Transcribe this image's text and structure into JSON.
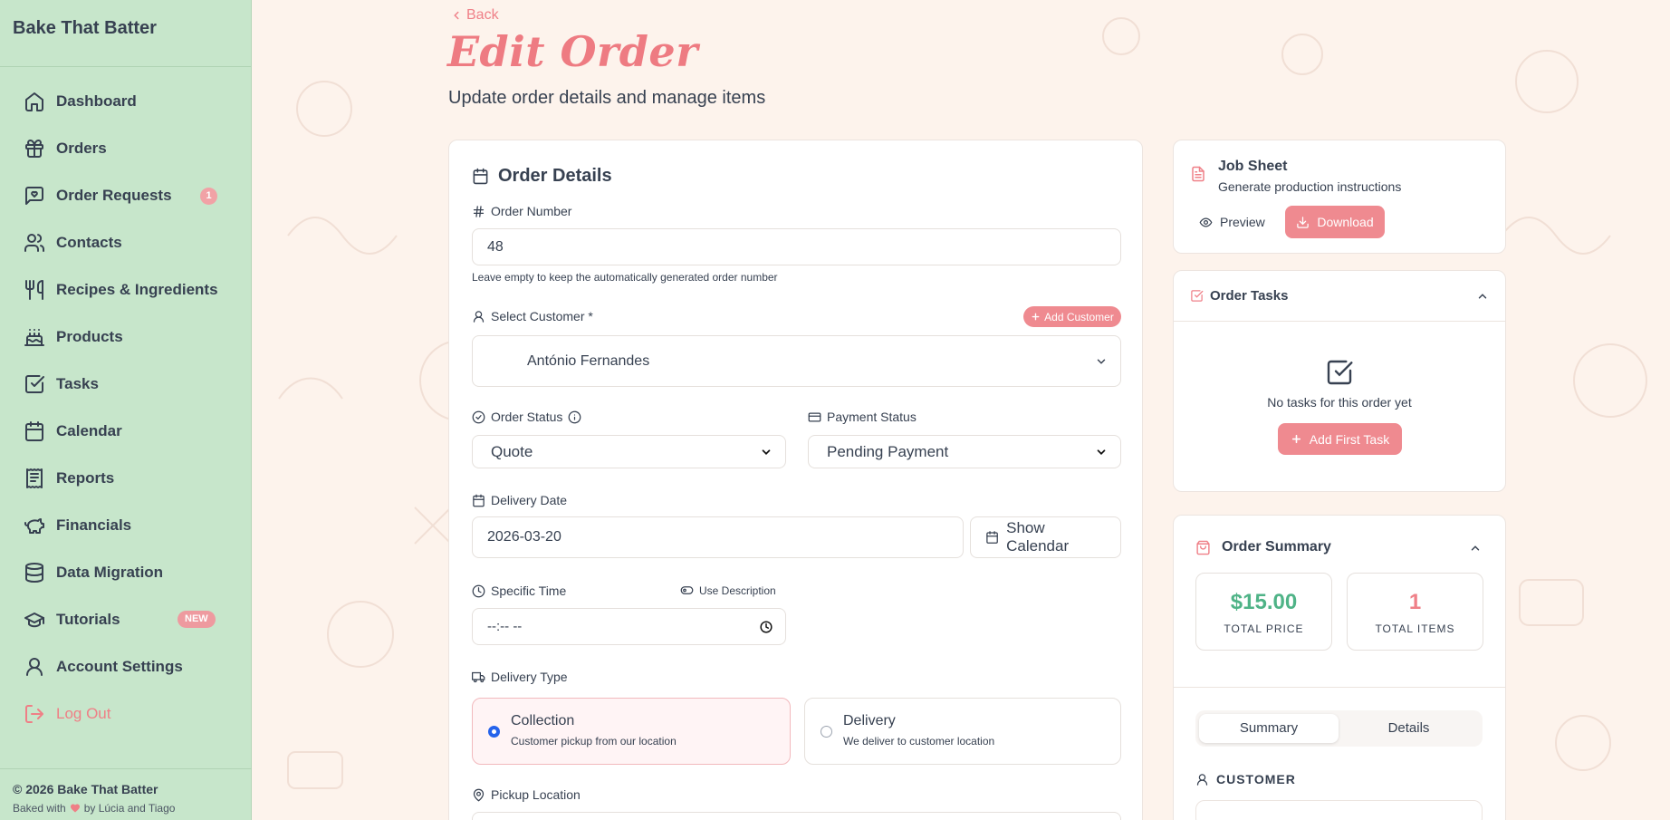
{
  "app": {
    "name": "Bake That Batter"
  },
  "sidebar": {
    "items": [
      {
        "label": "Dashboard",
        "icon": "home-icon"
      },
      {
        "label": "Orders",
        "icon": "gift-icon"
      },
      {
        "label": "Order Requests",
        "icon": "message-heart-icon",
        "badge": "1"
      },
      {
        "label": "Contacts",
        "icon": "users-icon"
      },
      {
        "label": "Recipes & Ingredients",
        "icon": "utensils-icon"
      },
      {
        "label": "Products",
        "icon": "cake-icon"
      },
      {
        "label": "Tasks",
        "icon": "check-square-icon"
      },
      {
        "label": "Calendar",
        "icon": "calendar-icon"
      },
      {
        "label": "Reports",
        "icon": "receipt-icon"
      },
      {
        "label": "Financials",
        "icon": "piggy-bank-icon"
      },
      {
        "label": "Data Migration",
        "icon": "database-icon"
      },
      {
        "label": "Tutorials",
        "icon": "graduation-cap-icon",
        "badge": "NEW"
      },
      {
        "label": "Account Settings",
        "icon": "user-icon"
      },
      {
        "label": "Log Out",
        "icon": "logout-icon"
      }
    ],
    "footer": {
      "copyright": "© 2026 Bake That Batter",
      "baked_prefix": "Baked with",
      "baked_suffix": "by Lúcia and Tiago"
    }
  },
  "header": {
    "back": "Back",
    "title": "Edit Order",
    "subtitle": "Update order details and manage items"
  },
  "order_details": {
    "title": "Order Details",
    "order_number_label": "Order Number",
    "order_number_value": "48",
    "order_number_hint": "Leave empty to keep the automatically generated order number",
    "customer_label": "Select Customer *",
    "add_customer": "Add Customer",
    "customer_value": "António Fernandes",
    "order_status_label": "Order Status",
    "order_status_value": "Quote",
    "payment_status_label": "Payment Status",
    "payment_status_value": "Pending Payment",
    "delivery_date_label": "Delivery Date",
    "delivery_date_value": "2026-03-20",
    "show_calendar": "Show Calendar",
    "specific_time_label": "Specific Time",
    "use_description": "Use Description",
    "time_value": "--:-- --",
    "delivery_type_label": "Delivery Type",
    "delivery_options": [
      {
        "title": "Collection",
        "sub": "Customer pickup from our location",
        "selected": true
      },
      {
        "title": "Delivery",
        "sub": "We deliver to customer location",
        "selected": false
      }
    ],
    "pickup_location_label": "Pickup Location"
  },
  "job_sheet": {
    "title": "Job Sheet",
    "subtitle": "Generate production instructions",
    "preview": "Preview",
    "download": "Download"
  },
  "order_tasks": {
    "title": "Order Tasks",
    "empty": "No tasks for this order yet",
    "add_first": "Add First Task"
  },
  "order_summary": {
    "title": "Order Summary",
    "total_price": "$15.00",
    "total_price_label": "TOTAL PRICE",
    "total_items": "1",
    "total_items_label": "TOTAL ITEMS",
    "tabs": [
      "Summary",
      "Details"
    ],
    "customer_heading": "CUSTOMER"
  },
  "colors": {
    "accent": "#ef8088",
    "sidebar": "#c7e6cb",
    "price": "#4fb387",
    "background": "#fdf3ec"
  }
}
